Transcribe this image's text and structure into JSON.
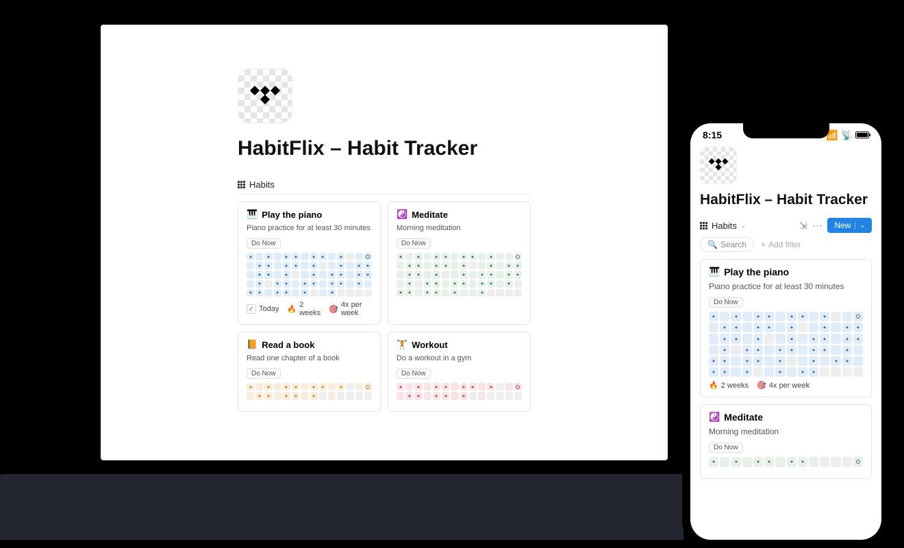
{
  "status_bar": {
    "time": "8:15"
  },
  "page": {
    "title": "HabitFlix – Habit Tracker"
  },
  "view": {
    "label": "Habits",
    "new_button": "New",
    "search_placeholder": "Search",
    "add_filter": "Add filter"
  },
  "tags": {
    "today": "Today",
    "streak": "2 weeks",
    "frequency": "4x per week"
  },
  "do_now_label": "Do Now",
  "habits": [
    {
      "id": "piano",
      "icon": "🎹",
      "title": "Play the piano",
      "subtitle": "Piano practice for at least 30 minutes",
      "theme": "blue",
      "rows": 5,
      "show_tags": [
        "today",
        "streak",
        "frequency"
      ]
    },
    {
      "id": "meditate",
      "icon": "☯️",
      "title": "Meditate",
      "subtitle": "Morning meditation",
      "theme": "green",
      "rows": 5,
      "show_tags": []
    },
    {
      "id": "read",
      "icon": "📙",
      "title": "Read a book",
      "subtitle": "Read one chapter of a book",
      "theme": "orange",
      "rows": 2,
      "show_tags": []
    },
    {
      "id": "workout",
      "icon": "🏋️",
      "title": "Workout",
      "subtitle": "Do a workout in a gym",
      "theme": "red",
      "rows": 2,
      "show_tags": []
    }
  ],
  "phone_habits": [
    {
      "id": "piano",
      "icon": "🎹",
      "title": "Play the piano",
      "subtitle": "Piano practice for at least 30 minutes",
      "theme": "blue",
      "rows": 6,
      "show_tags": [
        "streak",
        "frequency"
      ]
    },
    {
      "id": "meditate",
      "icon": "☯️",
      "title": "Meditate",
      "subtitle": "Morning meditation",
      "theme": "green",
      "rows": 1,
      "show_tags": []
    }
  ]
}
